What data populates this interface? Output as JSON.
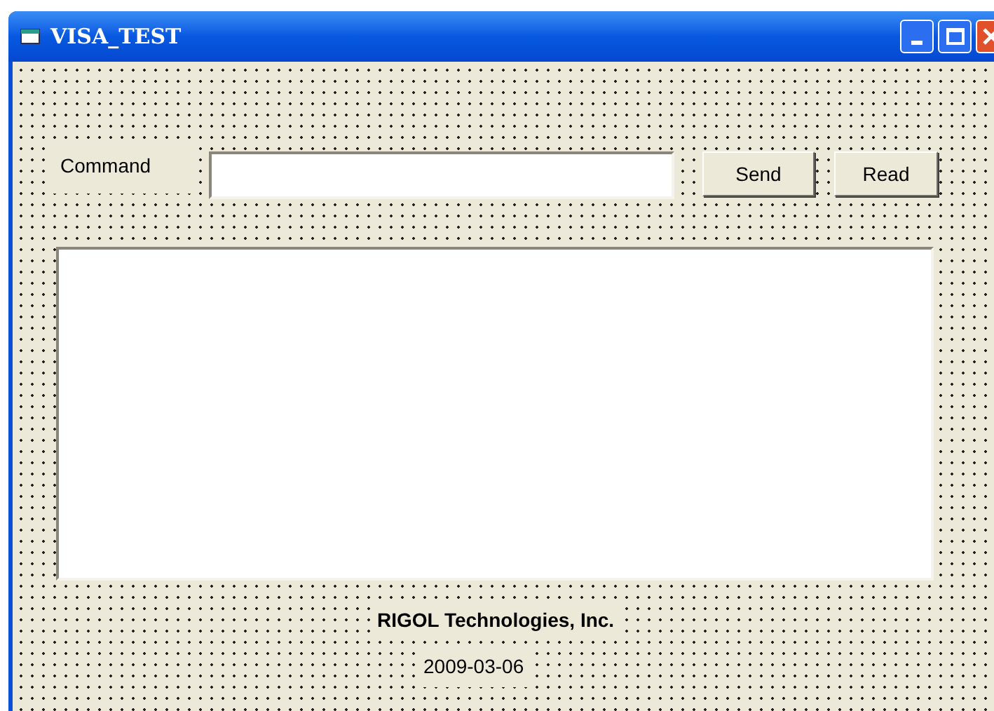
{
  "window": {
    "title": "VISA_TEST"
  },
  "command": {
    "label": "Command"
  },
  "buttons": [
    {
      "label": "Send"
    },
    {
      "label": "Read"
    }
  ],
  "footer": {
    "company": "RIGOL Technologies, Inc.",
    "date": "2009-03-06"
  }
}
